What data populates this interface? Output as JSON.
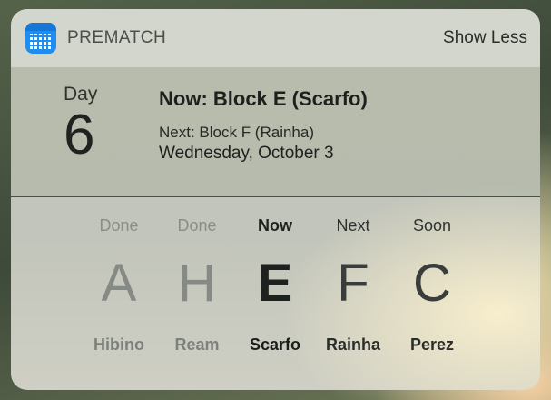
{
  "header": {
    "app_name": "PREMATCH",
    "show_less_label": "Show Less"
  },
  "summary": {
    "day_label": "Day",
    "day_number": "6",
    "now_title": "Now: Block E (Scarfo)",
    "next_line": "Next: Block F (Rainha)",
    "date_line": "Wednesday, October 3"
  },
  "blocks": [
    {
      "status": "Done",
      "letter": "A",
      "teacher": "Hibino"
    },
    {
      "status": "Done",
      "letter": "H",
      "teacher": "Ream"
    },
    {
      "status": "Now",
      "letter": "E",
      "teacher": "Scarfo"
    },
    {
      "status": "Next",
      "letter": "F",
      "teacher": "Rainha"
    },
    {
      "status": "Soon",
      "letter": "C",
      "teacher": "Perez"
    }
  ],
  "icons": {
    "app": "calendar-icon"
  }
}
